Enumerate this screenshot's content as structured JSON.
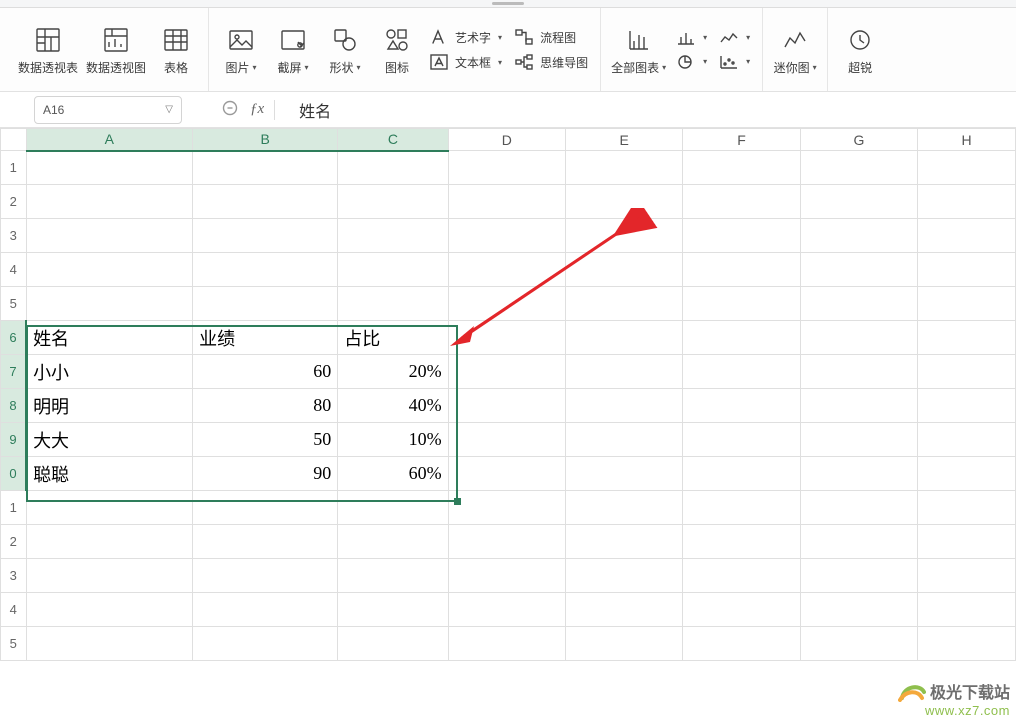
{
  "ribbon": {
    "pivot_table": "数据透视表",
    "pivot_chart": "数据透视图",
    "table": "表格",
    "picture": "图片",
    "screenshot": "截屏",
    "shapes": "形状",
    "icons": "图标",
    "wordart": "艺术字",
    "textbox": "文本框",
    "flowchart": "流程图",
    "mindmap": "思维导图",
    "all_charts": "全部图表",
    "sparkline": "迷你图",
    "more": "超锐"
  },
  "name_box": "A16",
  "formula_value": "姓名",
  "columns": [
    "A",
    "B",
    "C",
    "D",
    "E",
    "F",
    "G",
    "H"
  ],
  "row_labels": [
    "1",
    "2",
    "3",
    "4",
    "5",
    "6",
    "7",
    "8",
    "9",
    "0",
    "1",
    "2",
    "3",
    "4",
    "5"
  ],
  "table": {
    "headers": [
      "姓名",
      "业绩",
      "占比"
    ],
    "rows": [
      {
        "name": "小小",
        "score": "60",
        "pct": "20%"
      },
      {
        "name": "明明",
        "score": "80",
        "pct": "40%"
      },
      {
        "name": "大大",
        "score": "50",
        "pct": "10%"
      },
      {
        "name": "聪聪",
        "score": "90",
        "pct": "60%"
      }
    ]
  },
  "watermark": {
    "brand": "极光下载站",
    "url": "www.xz7.com"
  }
}
